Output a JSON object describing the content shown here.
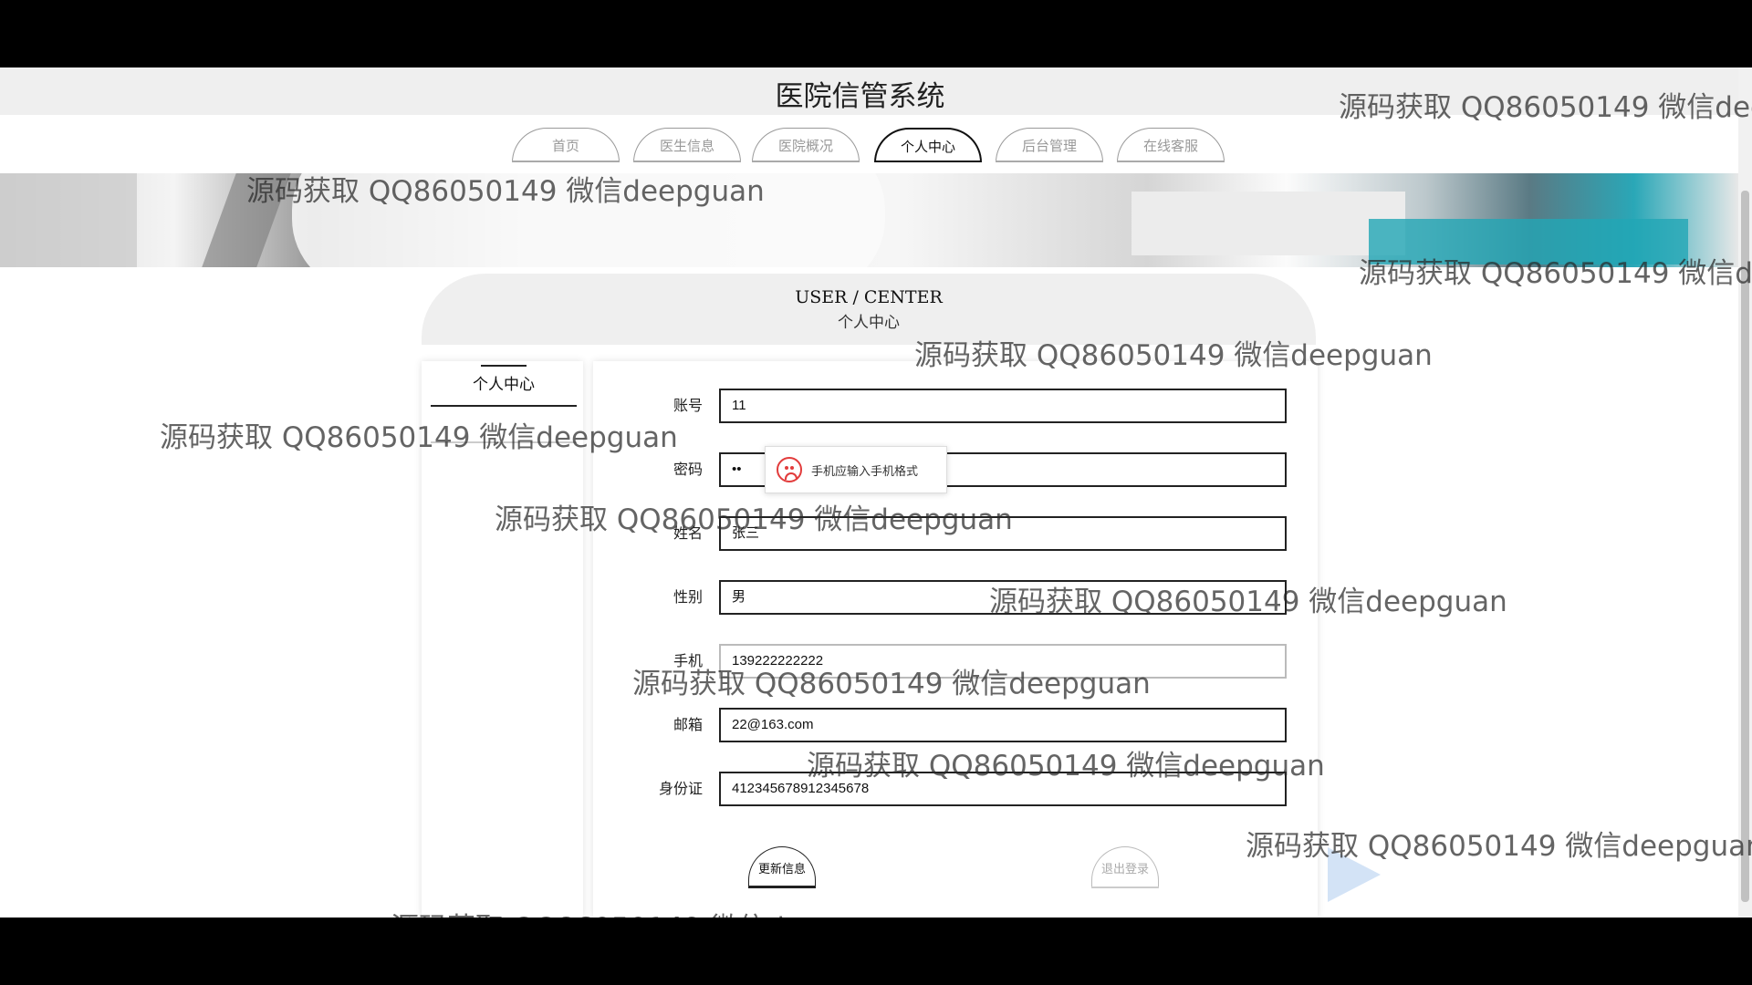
{
  "header": {
    "title": "医院信管系统"
  },
  "nav": {
    "tabs": [
      {
        "label": "首页",
        "active": false
      },
      {
        "label": "医生信息",
        "active": false
      },
      {
        "label": "医院概况",
        "active": false
      },
      {
        "label": "个人中心",
        "active": true
      },
      {
        "label": "后台管理",
        "active": false
      },
      {
        "label": "在线客服",
        "active": false
      }
    ]
  },
  "section": {
    "title_en": "USER / CENTER",
    "title_cn": "个人中心"
  },
  "side_menu": {
    "item_label": "个人中心"
  },
  "form": {
    "account_label": "账号",
    "account_value": "11",
    "password_label": "密码",
    "password_value": "••",
    "name_label": "姓名",
    "name_value": "张三",
    "gender_label": "性别",
    "gender_value": "男",
    "phone_label": "手机",
    "phone_value": "139222222222",
    "email_label": "邮箱",
    "email_value": "22@163.com",
    "idcard_label": "身份证",
    "idcard_value": "412345678912345678",
    "tooltip_text": "手机应输入手机格式",
    "update_button": "更新信息",
    "logout_button": "退出登录"
  },
  "watermark": {
    "text": "源码获取 QQ86050149 微信deepguan"
  },
  "colors": {
    "accent": "#111111",
    "error_icon": "#e23c3c",
    "teal": "#22a6b5"
  }
}
